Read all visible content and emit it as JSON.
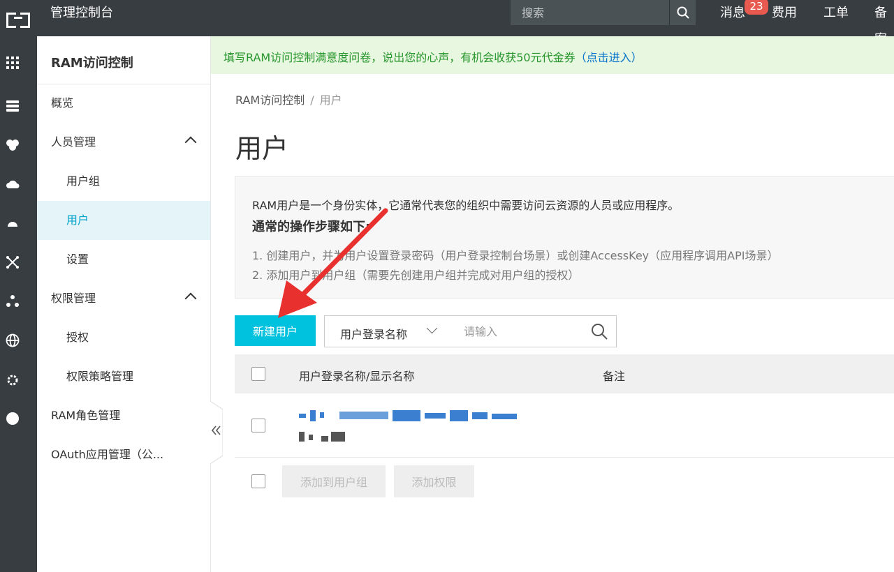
{
  "topbar": {
    "title": "管理控制台",
    "search_placeholder": "搜索",
    "links": {
      "messages": "消息",
      "fees": "费用",
      "tickets": "工单",
      "filing": "备案"
    },
    "message_badge": "23"
  },
  "sidebar": {
    "title": "RAM访问控制",
    "items": [
      {
        "label": "概览"
      },
      {
        "label": "人员管理"
      },
      {
        "label": "用户组"
      },
      {
        "label": "用户"
      },
      {
        "label": "设置"
      },
      {
        "label": "权限管理"
      },
      {
        "label": "授权"
      },
      {
        "label": "权限策略管理"
      },
      {
        "label": "RAM角色管理"
      },
      {
        "label": "OAuth应用管理（公..."
      }
    ],
    "collapse_icon": "double-chevron-left-icon"
  },
  "notice": {
    "text": "填写RAM访问控制满意度问卷，说出您的心声，有机会收获50元代金券",
    "link": "（点击进入）"
  },
  "breadcrumb": {
    "root": "RAM访问控制",
    "separator": "/",
    "current": "用户"
  },
  "page": {
    "title": "用户"
  },
  "info": {
    "line1": "RAM用户是一个身份实体，它通常代表您的组织中需要访问云资源的人员或应用程序。",
    "line2": "通常的操作步骤如下:",
    "step1": "1. 创建用户，并为用户设置登录密码（用户登录控制台场景）或创建AccessKey（应用程序调用API场景）",
    "step2": "2. 添加用户到用户组（需要先创建用户组并完成对用户组的授权）"
  },
  "toolbar": {
    "create_label": "新建用户",
    "filter_field": "用户登录名称",
    "filter_placeholder": "请输入"
  },
  "table": {
    "columns": {
      "name": "用户登录名称/显示名称",
      "remark": "备注"
    }
  },
  "footer": {
    "add_to_group": "添加到用户组",
    "add_permission": "添加权限"
  },
  "colors": {
    "accent": "#00c1de",
    "topbar": "#373d41",
    "active_bg": "#e4f4f8",
    "arrow": "#e8312f"
  }
}
